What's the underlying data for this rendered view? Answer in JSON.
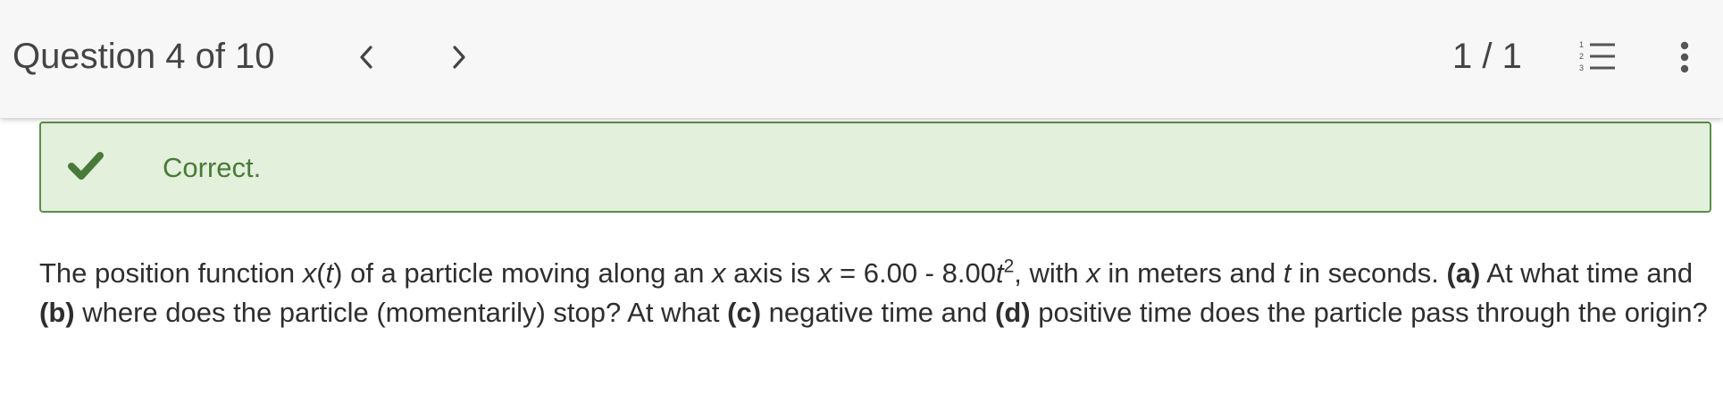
{
  "header": {
    "title": "Question 4 of 10",
    "counter": "1 / 1",
    "prev_icon": "chevron-left-icon",
    "next_icon": "chevron-right-icon",
    "list_icon": "numbered-list-icon",
    "more_icon": "more-vertical-icon"
  },
  "feedback": {
    "icon": "checkmark-icon",
    "text": "Correct.",
    "background": "#e3f0db",
    "border": "#5b8f4a",
    "text_color": "#4a7a3a"
  },
  "question": {
    "p1": "The position function ",
    "x": "x",
    "p2": "(",
    "t": "t",
    "p3": ") of a particle moving along an ",
    "x2": "x",
    "p4": " axis is ",
    "x3": "x",
    "p5": " = 6.00 - 8.00",
    "t2": "t",
    "exp": "2",
    "p6": ", with ",
    "x4": "x",
    "p7": " in meters and ",
    "t3": "t",
    "p8": " in seconds. ",
    "a": "(a)",
    "p9": " At what time and ",
    "b": "(b)",
    "p10": " where does the particle (momentarily) stop? At what ",
    "c": "(c)",
    "p11": " negative time and ",
    "d": "(d)",
    "p12": " positive time does the particle pass through the origin?"
  }
}
